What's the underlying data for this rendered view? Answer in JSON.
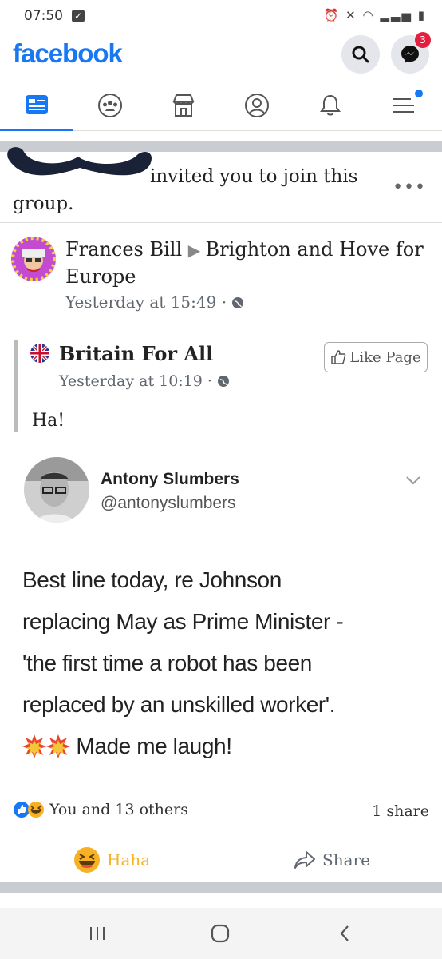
{
  "status": {
    "time": "07:50"
  },
  "header": {
    "logo": "facebook",
    "messenger_badge": "3"
  },
  "invite": {
    "text": "invited you to join this group."
  },
  "post": {
    "author": "Frances Bill",
    "group": "Brighton and Hove for Europe",
    "timestamp": "Yesterday at 15:49 ·",
    "shared_page": "Britain For All",
    "like_page_label": "Like Page",
    "shared_timestamp": "Yesterday at 10:19 ·",
    "caption": "Ha!"
  },
  "tweet": {
    "name": "Antony Slumbers",
    "handle": "@antonyslumbers",
    "text_line1": "Best line today, re Johnson",
    "text_line2": "replacing May as Prime Minister -",
    "text_line3": "'the first time a robot has been",
    "text_line4": "replaced by an unskilled worker'.",
    "text_line5": "Made me laugh!"
  },
  "engagement": {
    "reactions_text": "You and 13 others",
    "shares_text": "1 share"
  },
  "actions": {
    "haha_label": "Haha",
    "share_label": "Share"
  },
  "icons": {
    "nav": [
      "news-feed-icon",
      "groups-icon",
      "marketplace-icon",
      "profile-icon",
      "bell-icon",
      "menu-icon"
    ]
  },
  "colors": {
    "brand": "#1877f2",
    "haha": "#f7b125",
    "badge": "#e41e3f"
  }
}
